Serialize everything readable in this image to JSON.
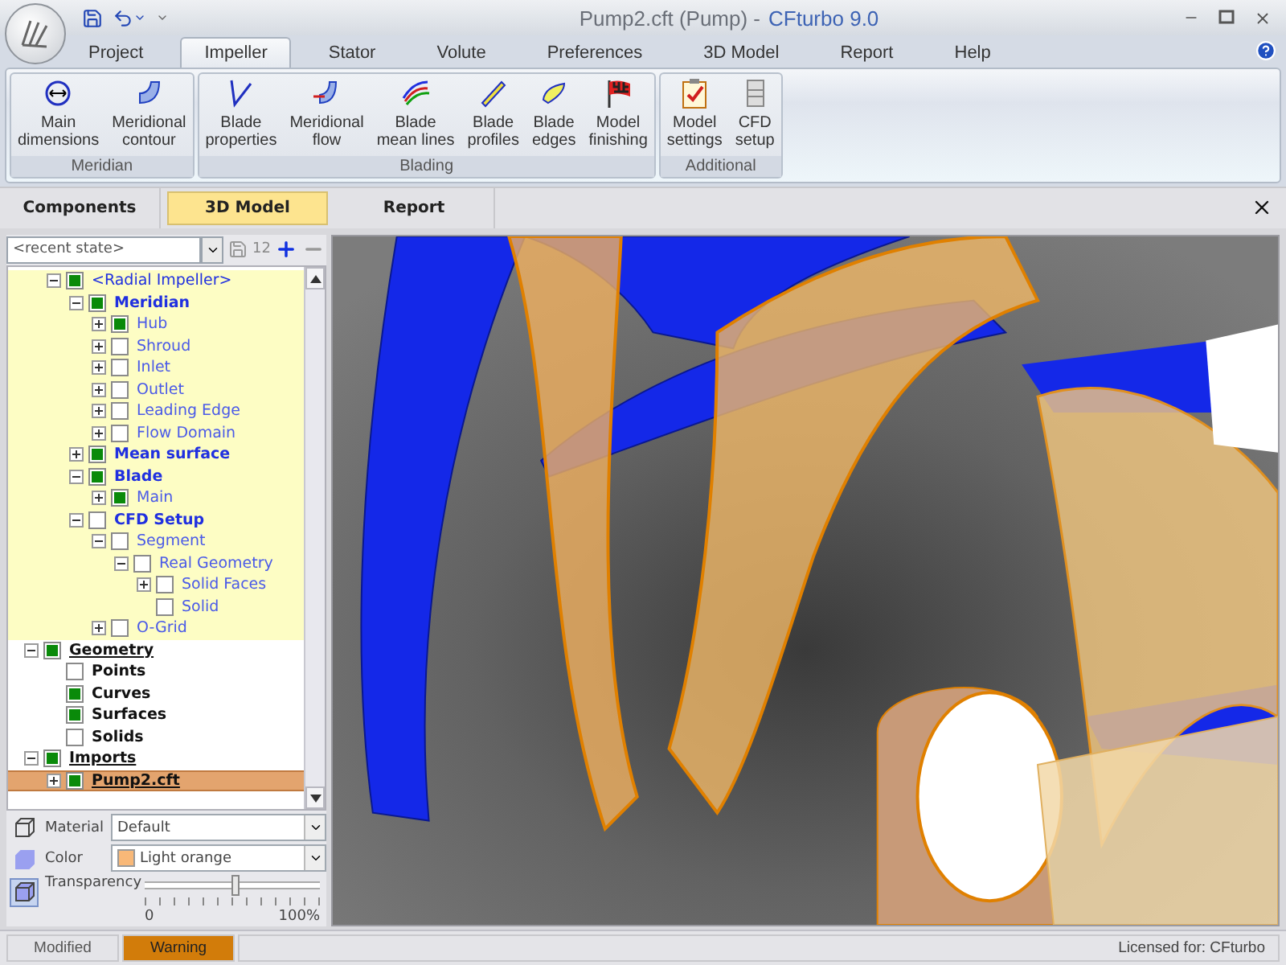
{
  "window": {
    "title": "Pump2.cft (Pump) -",
    "app_name": "CFturbo 9.0"
  },
  "ribbon_tabs": [
    {
      "label": "Project",
      "selected": false
    },
    {
      "label": "Impeller",
      "selected": true
    },
    {
      "label": "Stator",
      "selected": false
    },
    {
      "label": "Volute",
      "selected": false
    },
    {
      "label": "Preferences",
      "selected": false
    },
    {
      "label": "3D Model",
      "selected": false
    },
    {
      "label": "Report",
      "selected": false
    },
    {
      "label": "Help",
      "selected": false
    }
  ],
  "ribbon_groups": [
    {
      "name": "Meridian",
      "buttons": [
        {
          "lines": [
            "Main",
            "dimensions"
          ]
        },
        {
          "lines": [
            "Meridional",
            "contour"
          ]
        }
      ]
    },
    {
      "name": "Blading",
      "buttons": [
        {
          "lines": [
            "Blade",
            "properties"
          ]
        },
        {
          "lines": [
            "Meridional",
            "flow"
          ]
        },
        {
          "lines": [
            "Blade",
            "mean lines"
          ]
        },
        {
          "lines": [
            "Blade",
            "profiles"
          ]
        },
        {
          "lines": [
            "Blade",
            "edges"
          ]
        },
        {
          "lines": [
            "Model",
            "finishing"
          ]
        }
      ]
    },
    {
      "name": "Additional",
      "buttons": [
        {
          "lines": [
            "Model",
            "settings"
          ]
        },
        {
          "lines": [
            "CFD",
            "setup"
          ]
        }
      ]
    }
  ],
  "panel_tabs": [
    {
      "label": "Components",
      "selected": false
    },
    {
      "label": "3D Model",
      "selected": true
    },
    {
      "label": "Report",
      "selected": false
    }
  ],
  "state_toolbar": {
    "placeholder": "<recent state>",
    "numbering_label": "12"
  },
  "tree": [
    {
      "label": "<Radial Impeller>",
      "kind": "root",
      "checked": true,
      "selected": false,
      "expanded": true,
      "children": [
        {
          "label": "Meridian",
          "kind": "group",
          "checked": true,
          "selected": false,
          "expanded": true,
          "children": [
            {
              "label": "Hub",
              "kind": "item",
              "checked": true,
              "selected": false,
              "expanded": false
            },
            {
              "label": "Shroud",
              "kind": "item",
              "checked": false,
              "selected": false,
              "expanded": false
            },
            {
              "label": "Inlet",
              "kind": "item",
              "checked": false,
              "selected": false,
              "expanded": false
            },
            {
              "label": "Outlet",
              "kind": "item",
              "checked": false,
              "selected": false,
              "expanded": false
            },
            {
              "label": "Leading Edge",
              "kind": "item",
              "checked": false,
              "selected": false,
              "expanded": false
            },
            {
              "label": "Flow Domain",
              "kind": "item",
              "checked": false,
              "selected": false,
              "expanded": false
            }
          ]
        },
        {
          "label": "Mean surface",
          "kind": "group",
          "checked": true,
          "selected": false,
          "expanded": false
        },
        {
          "label": "Blade",
          "kind": "group",
          "checked": true,
          "selected": false,
          "expanded": true,
          "children": [
            {
              "label": "Main",
              "kind": "item",
              "checked": true,
              "selected": false,
              "expanded": false
            }
          ]
        },
        {
          "label": "CFD Setup",
          "kind": "group",
          "checked": false,
          "selected": false,
          "expanded": true,
          "children": [
            {
              "label": "Segment",
              "kind": "item",
              "checked": false,
              "selected": false,
              "expanded": true,
              "children": [
                {
                  "label": "Real Geometry",
                  "kind": "item",
                  "checked": false,
                  "selected": false,
                  "expanded": true,
                  "children": [
                    {
                      "label": "Solid Faces",
                      "kind": "item",
                      "checked": false,
                      "selected": false,
                      "expanded": false
                    },
                    {
                      "label": "Solid",
                      "kind": "item",
                      "checked": false,
                      "selected": false
                    }
                  ]
                }
              ]
            },
            {
              "label": "O-Grid",
              "kind": "item",
              "checked": false,
              "selected": false,
              "expanded": false
            }
          ]
        }
      ]
    },
    {
      "label": "Geometry",
      "kind": "heading",
      "checked": true,
      "selected": false,
      "expanded": true,
      "children": [
        {
          "label": "Points",
          "kind": "group",
          "checked": false,
          "selected": false
        },
        {
          "label": "Curves",
          "kind": "group",
          "checked": true,
          "selected": false
        },
        {
          "label": "Surfaces",
          "kind": "group",
          "checked": true,
          "selected": false
        },
        {
          "label": "Solids",
          "kind": "group",
          "checked": false,
          "selected": false
        }
      ]
    },
    {
      "label": "Imports",
      "kind": "heading",
      "checked": true,
      "selected": false,
      "expanded": true,
      "children": [
        {
          "label": "Pump2.cft",
          "kind": "heading",
          "checked": true,
          "selected": true,
          "expanded": false
        }
      ]
    }
  ],
  "properties": {
    "material_label": "Material",
    "material": "Default",
    "color_label": "Color",
    "color_name": "Light orange",
    "color": "#f8b878",
    "transparency_label": "Transparency",
    "transparency": {
      "level": 0.51,
      "min_label": "0",
      "max_label": "100%"
    },
    "view_modes": [
      {
        "selected": false
      },
      {
        "selected": false
      },
      {
        "selected": true
      }
    ]
  },
  "status_bar": {
    "items": [
      {
        "label": "Modified",
        "highlighted": false
      },
      {
        "label": "Warning",
        "highlighted": true
      }
    ],
    "license": "Licensed for: CFturbo"
  }
}
